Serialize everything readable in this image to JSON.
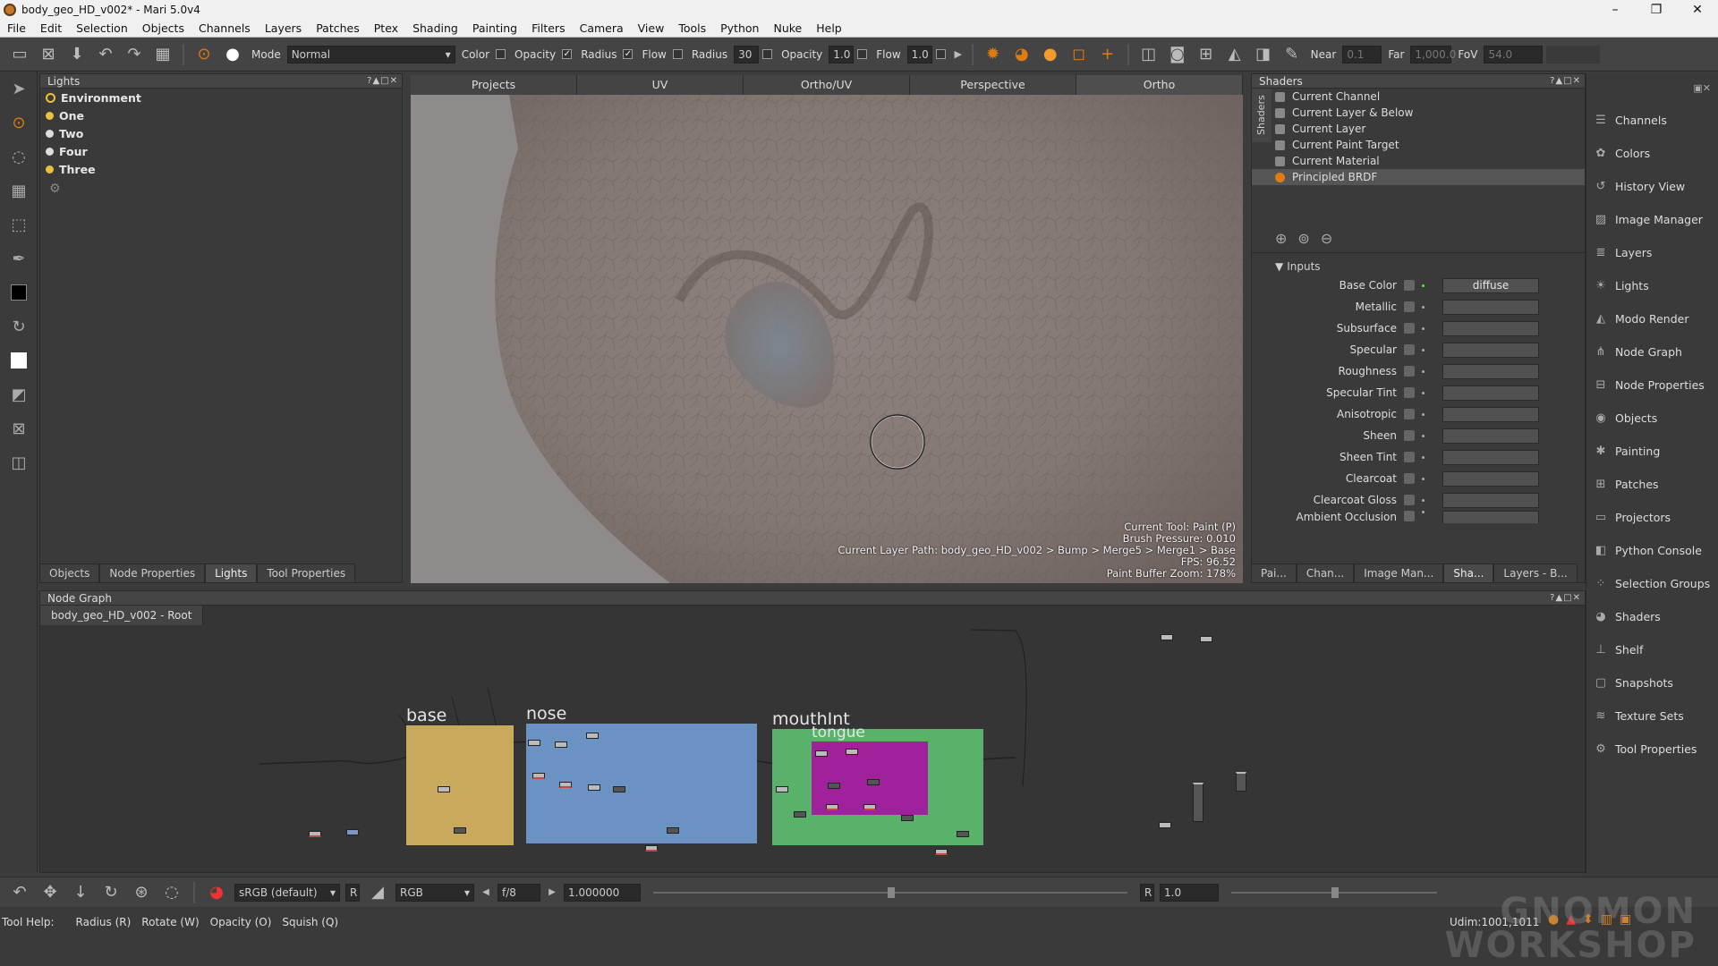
{
  "window": {
    "title": "body_geo_HD_v002* - Mari 5.0v4",
    "min": "–",
    "max": "❐",
    "close": "✕"
  },
  "menu": [
    "File",
    "Edit",
    "Selection",
    "Objects",
    "Channels",
    "Layers",
    "Patches",
    "Ptex",
    "Shading",
    "Painting",
    "Filters",
    "Camera",
    "View",
    "Tools",
    "Python",
    "Nuke",
    "Help"
  ],
  "toolbar": {
    "mode_label": "Mode",
    "mode_value": "Normal",
    "color_label": "Color",
    "opacity_chk_label": "Opacity",
    "radius_chk_label": "Radius",
    "flow_chk_label": "Flow",
    "radius_label": "Radius",
    "radius_value": "30",
    "opacity_label": "Opacity",
    "opacity_value": "1.0",
    "flow_label": "Flow",
    "flow_value": "1.0",
    "near_label": "Near",
    "near_value": "0.1",
    "far_label": "Far",
    "far_value": "1,000.0",
    "fov_label": "FoV",
    "fov_value": "54.0"
  },
  "lights_panel": {
    "title": "Lights",
    "controls": "?▲□✕",
    "items": [
      "Environment",
      "One",
      "Two",
      "Four",
      "Three"
    ],
    "tabs": [
      "Objects",
      "Node Properties",
      "Lights",
      "Tool Properties"
    ]
  },
  "viewport": {
    "tabs": [
      "Projects",
      "UV",
      "Ortho/UV",
      "Perspective",
      "Ortho"
    ],
    "info": {
      "tool": "Current Tool: Paint (P)",
      "pressure": "Brush Pressure: 0.010",
      "layer_path": "Current Layer Path: body_geo_HD_v002 > Bump > Merge5 > Merge1 > Base",
      "fps": "FPS: 96.52",
      "zoom": "Paint Buffer Zoom: 178%"
    }
  },
  "shaders_panel": {
    "title": "Shaders",
    "side_tab": "Shaders",
    "controls": "?▲□✕",
    "items": [
      "Current Channel",
      "Current Layer & Below",
      "Current Layer",
      "Current Paint Target",
      "Current Material",
      "Principled BRDF"
    ],
    "inputs_label": "Inputs",
    "inputs": [
      {
        "label": "Base Color",
        "value": "diffuse"
      },
      {
        "label": "Metallic",
        "value": ""
      },
      {
        "label": "Subsurface",
        "value": ""
      },
      {
        "label": "Specular",
        "value": ""
      },
      {
        "label": "Roughness",
        "value": ""
      },
      {
        "label": "Specular Tint",
        "value": ""
      },
      {
        "label": "Anisotropic",
        "value": ""
      },
      {
        "label": "Sheen",
        "value": ""
      },
      {
        "label": "Sheen Tint",
        "value": ""
      },
      {
        "label": "Clearcoat",
        "value": ""
      },
      {
        "label": "Clearcoat Gloss",
        "value": ""
      },
      {
        "label": "Ambient Occlusion",
        "value": ""
      }
    ],
    "bottom_tabs": [
      "Pai...",
      "Chan...",
      "Image Man...",
      "Sha...",
      "Layers - B..."
    ]
  },
  "right_dock": [
    "Channels",
    "Colors",
    "History View",
    "Image Manager",
    "Layers",
    "Lights",
    "Modo Render",
    "Node Graph",
    "Node Properties",
    "Objects",
    "Painting",
    "Patches",
    "Projectors",
    "Python Console",
    "Selection Groups",
    "Shaders",
    "Shelf",
    "Snapshots",
    "Texture Sets",
    "Tool Properties"
  ],
  "node_graph": {
    "title": "Node Graph",
    "controls": "?▲□✕",
    "tab": "body_geo_HD_v002 - Root",
    "backdrops": [
      {
        "name": "base",
        "color": "#c9a95c"
      },
      {
        "name": "nose",
        "color": "#6a93c4"
      },
      {
        "name": "mouthInt",
        "color": "#58b26a"
      },
      {
        "name": "tongue",
        "color": "#a0219c"
      }
    ]
  },
  "bottom_bar": {
    "colorspace": "sRGB (default)",
    "r_btn": "R",
    "channel": "RGB",
    "fstop": "f/8",
    "gain": "1.000000",
    "r_label": "R",
    "r_value": "1.0"
  },
  "status": {
    "tool_help": "Tool Help:",
    "hints": [
      "Radius (R)",
      "Rotate (W)",
      "Opacity (O)",
      "Squish (Q)"
    ],
    "udim": "Udim:1001,1011"
  },
  "watermark": {
    "line1": "GNOMON",
    "line2": "WORKSHOP"
  },
  "colors": {
    "accent": "#e07a12",
    "bulb": "#e8c23a"
  }
}
